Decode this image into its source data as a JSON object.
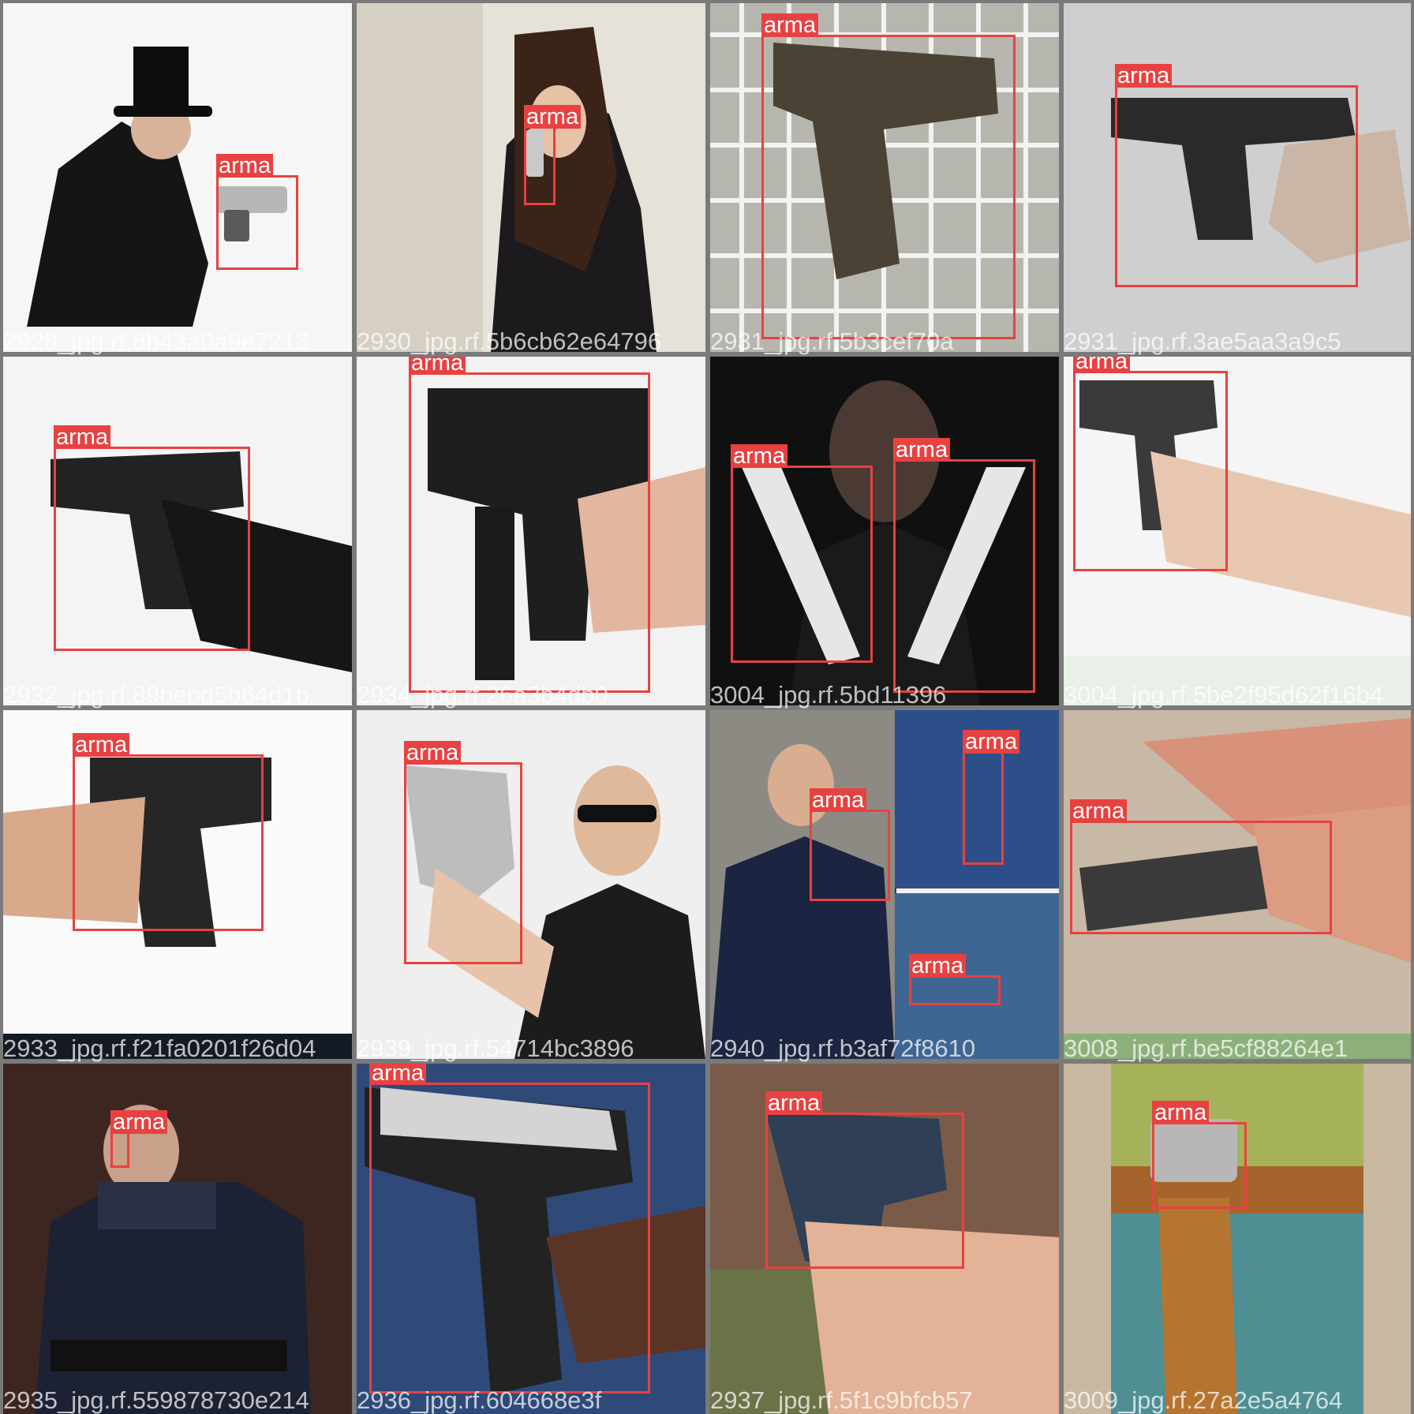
{
  "detection_label": "arma",
  "colors": {
    "box": "#e84141",
    "label_text": "#ffffff",
    "separator": "#7a7a7a"
  },
  "tiles": [
    {
      "id": "t1",
      "caption": "2928_jpg.rf.8b43a0a9e7213",
      "scene": "man in top hat with revolver",
      "bg": "#f6f6f6",
      "dets": [
        "arma"
      ]
    },
    {
      "id": "t2",
      "caption": "2930_jpg.rf.5b6cb62e64796",
      "scene": "woman aiming handgun",
      "bg": "#d9d2c8",
      "dets": [
        "arma"
      ]
    },
    {
      "id": "t3",
      "caption": "2931_jpg.rf.5b3cef70a",
      "scene": "pistol over wire grid",
      "bg": "#b7b6ae",
      "dets": [
        "arma"
      ]
    },
    {
      "id": "t4",
      "caption": "2931_jpg.rf.3ae5aa3a9c5",
      "scene": "hand holding pistol",
      "bg": "#cfcfcf",
      "dets": [
        "arma"
      ]
    },
    {
      "id": "t5",
      "caption": "2932_jpg.rf.89bebd5b64d1b",
      "scene": "gloved hand with pistol",
      "bg": "#f4f4f4",
      "dets": [
        "arma"
      ]
    },
    {
      "id": "t6",
      "caption": "2934_jpg.rf.26a3b4db0",
      "scene": "submachine gun in hand",
      "bg": "#f2f2f2",
      "dets": [
        "arma"
      ]
    },
    {
      "id": "t7",
      "caption": "3004_jpg.rf.5bd11396",
      "scene": "man holding two pistols",
      "bg": "#101010",
      "dets": [
        "arma",
        "arma"
      ]
    },
    {
      "id": "t8",
      "caption": "3004_jpg.rf.5be2f95d62f16b4",
      "scene": "hand holding small pistol",
      "bg": "#f5f5f5",
      "dets": [
        "arma"
      ]
    },
    {
      "id": "t9",
      "caption": "2933_jpg.rf.f21fa0201f26d04",
      "scene": "hand gripping pistol",
      "bg": "#fafafa",
      "dets": [
        "arma"
      ]
    },
    {
      "id": "t10",
      "caption": "2939_jpg.rf.54714bc3896",
      "scene": "man in sunglasses aiming",
      "bg": "#efefef",
      "dets": [
        "arma"
      ]
    },
    {
      "id": "t11",
      "caption": "2940_jpg.rf.b3af72f8610",
      "scene": "officer collage",
      "bg": "#4b6b8e",
      "dets": [
        "arma",
        "arma",
        "arma"
      ]
    },
    {
      "id": "t12",
      "caption": "3008_jpg.rf.be5cf88264e1",
      "scene": "illustrated pistol slide",
      "bg": "#c8b8a6",
      "dets": [
        "arma"
      ]
    },
    {
      "id": "t13",
      "caption": "2935_jpg.rf.559878730e214",
      "scene": "police officer aiming",
      "bg": "#3d2620",
      "dets": [
        "arma"
      ]
    },
    {
      "id": "t14",
      "caption": "2936_jpg.rf.604668e3f",
      "scene": "hands holding pistol",
      "bg": "#2f4a78",
      "dets": [
        "arma"
      ]
    },
    {
      "id": "t15",
      "caption": "2937_jpg.rf.5f1c9bfcb57",
      "scene": "hands holding pistol outdoors",
      "bg": "#7a5a48",
      "dets": [
        "arma"
      ]
    },
    {
      "id": "t16",
      "caption": "3009_jpg.rf.27a2e5a4764",
      "scene": "revolver and holster drawing",
      "bg": "#c9b8a0",
      "dets": [
        "arma"
      ]
    }
  ]
}
